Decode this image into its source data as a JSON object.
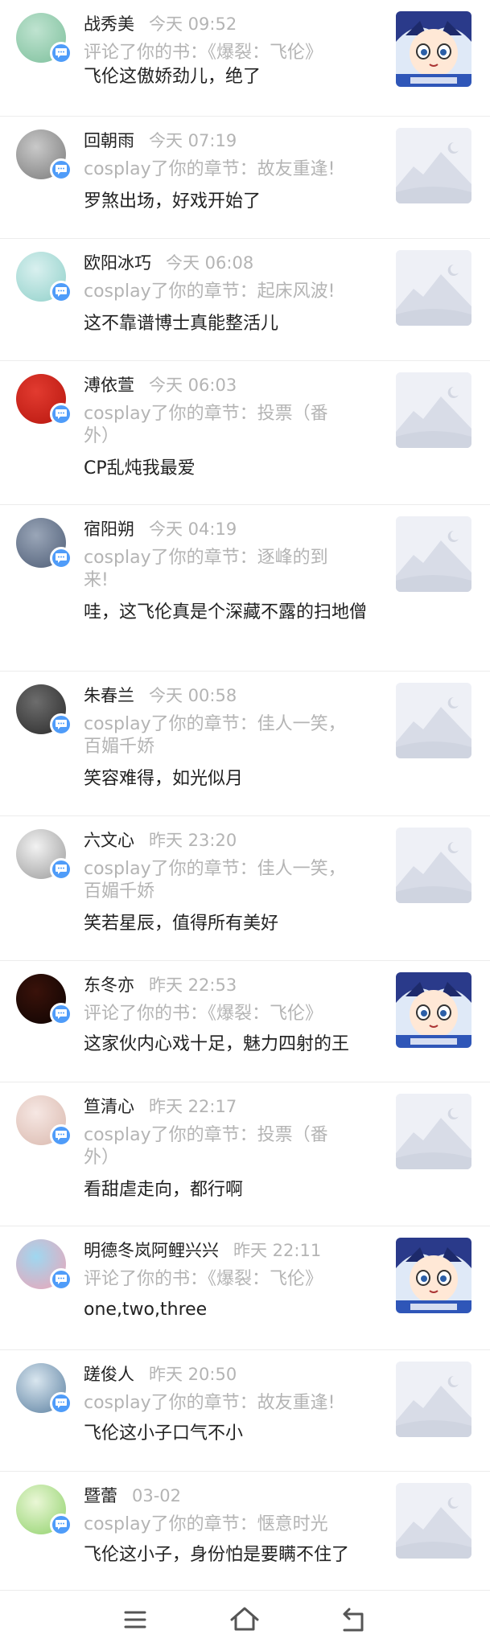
{
  "feed": [
    {
      "name": "战秀美",
      "time": "今天 09:52",
      "action": "评论了你的书：《爆裂：飞伦》",
      "comment": "飞伦这傲娇劲儿，绝了",
      "thumb": "cover"
    },
    {
      "name": "回朝雨",
      "time": "今天 07:19",
      "action": "cosplay了你的章节：故友重逢!",
      "comment": "罗煞出场，好戏开始了",
      "thumb": "placeholder"
    },
    {
      "name": "欧阳冰巧",
      "time": "今天 06:08",
      "action": "cosplay了你的章节：起床风波!",
      "comment": "这不靠谱博士真能整活儿",
      "thumb": "placeholder"
    },
    {
      "name": "溥依萱",
      "time": "今天 06:03",
      "action": "cosplay了你的章节：投票（番外）",
      "comment": "CP乱炖我最爱",
      "thumb": "placeholder"
    },
    {
      "name": "宿阳朔",
      "time": "今天 04:19",
      "action": "cosplay了你的章节：逐峰的到来!",
      "comment": "哇，这飞伦真是个深藏不露的扫地僧",
      "thumb": "placeholder"
    },
    {
      "name": "朱春兰",
      "time": "今天 00:58",
      "action": "cosplay了你的章节：佳人一笑，百媚千娇",
      "comment": "笑容难得，如光似月",
      "thumb": "placeholder"
    },
    {
      "name": "六文心",
      "time": "昨天 23:20",
      "action": "cosplay了你的章节：佳人一笑，百媚千娇",
      "comment": "笑若星辰，值得所有美好",
      "thumb": "placeholder"
    },
    {
      "name": "东冬亦",
      "time": "昨天 22:53",
      "action": "评论了你的书：《爆裂：飞伦》",
      "comment": "这家伙内心戏十足，魅力四射的王",
      "thumb": "cover"
    },
    {
      "name": "笪清心",
      "time": "昨天 22:17",
      "action": "cosplay了你的章节：投票（番外）",
      "comment": "看甜虐走向，都行啊",
      "thumb": "placeholder"
    },
    {
      "name": "明德冬岚阿鲤兴兴",
      "time": "昨天 22:11",
      "action": "评论了你的书：《爆裂：飞伦》",
      "comment": "one,two,three",
      "thumb": "cover"
    },
    {
      "name": "蹉俊人",
      "time": "昨天 20:50",
      "action": "cosplay了你的章节：故友重逢!",
      "comment": "飞伦这小子口气不小",
      "thumb": "placeholder"
    },
    {
      "name": "暨蕾",
      "time": "03-02",
      "action": "cosplay了你的章节：惬意时光",
      "comment": "飞伦这小子，身份怕是要瞒不住了",
      "thumb": "placeholder"
    }
  ],
  "navbar": {
    "menu_icon": "menu-icon",
    "home_icon": "home-icon",
    "back_icon": "back-icon"
  },
  "colors": {
    "badge": "#4f9cf9",
    "muted_text": "#b4b4b4",
    "text": "#222222"
  }
}
